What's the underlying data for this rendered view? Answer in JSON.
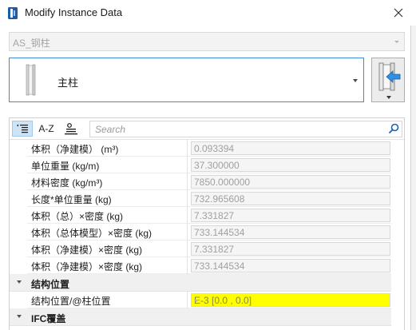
{
  "window": {
    "title": "Modify Instance Data"
  },
  "style_combo": {
    "value": "AS_钢柱"
  },
  "element_combo": {
    "value": "主柱"
  },
  "toolbar": {
    "sort_alpha_label": "A-Z",
    "search_placeholder": "Search"
  },
  "properties": {
    "rows": [
      {
        "label": "体积（净建模） (m³)",
        "value": "0.093394"
      },
      {
        "label": "单位重量 (kg/m)",
        "value": "37.300000"
      },
      {
        "label": "材料密度 (kg/m³)",
        "value": "7850.000000"
      },
      {
        "label": "长度*单位重量 (kg)",
        "value": "732.965608"
      },
      {
        "label": "体积（总）×密度 (kg)",
        "value": "7.331827"
      },
      {
        "label": "体积（总体模型）×密度 (kg)",
        "value": "733.144534"
      },
      {
        "label": "体积（净建模）×密度 (kg)",
        "value": "7.331827"
      },
      {
        "label": "体积（净建模）×密度 (kg)",
        "value": "733.144534"
      }
    ],
    "group_location": {
      "title": "结构位置",
      "rows": [
        {
          "label": "结构位置/@柱位置",
          "value": "E-3 [0.0 , 0.0]"
        }
      ]
    },
    "group_ifc": {
      "title": "IFC覆盖"
    }
  },
  "colors": {
    "accent": "#3c8bd9",
    "highlight": "#ffff00",
    "toolbar_active": "#cde4f7"
  }
}
